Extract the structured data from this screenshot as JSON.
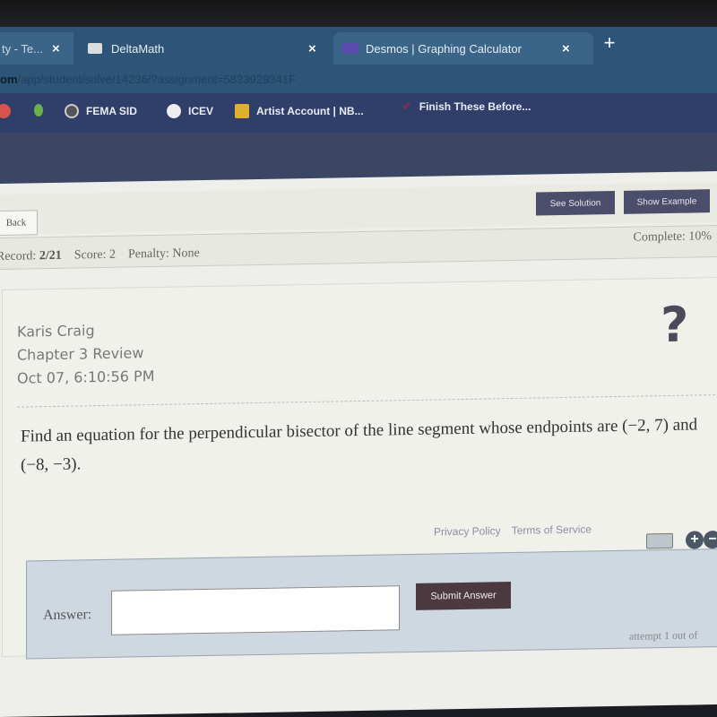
{
  "browser": {
    "tabs": [
      {
        "label": "ty - Te...",
        "state": "inactive"
      },
      {
        "label": "DeltaMath",
        "state": "active"
      },
      {
        "label": "Desmos | Graphing Calculator",
        "state": "inactive"
      }
    ],
    "close_glyph": "×",
    "new_tab_glyph": "+",
    "url_host": "om",
    "url_path": "/app/student/solve/14236/?assignment=5833929341F",
    "bookmarks": [
      {
        "label": ""
      },
      {
        "label": ""
      },
      {
        "label": "FEMA SID"
      },
      {
        "label": "ICEV"
      },
      {
        "label": "Artist Account | NB..."
      },
      {
        "label": "Finish These Before..."
      }
    ]
  },
  "toolbar": {
    "back_label": "Back",
    "see_solution_label": "See Solution",
    "show_example_label": "Show Example"
  },
  "status": {
    "record_label": "Record:",
    "record_value": "2/21",
    "score_label": "Score:",
    "score_value": "2",
    "penalty_label": "Penalty:",
    "penalty_value": "None",
    "complete_label": "Complete:",
    "complete_value": "10%"
  },
  "problem": {
    "student_name": "Karis Craig",
    "assignment": "Chapter 3 Review",
    "timestamp": "Oct 07, 6:10:56 PM",
    "help_glyph": "?",
    "question": "Find an equation for the perpendicular bisector of the line segment whose endpoints are (−2, 7) and (−8, −3)."
  },
  "answer": {
    "label": "Answer:",
    "value": "",
    "placeholder": "",
    "submit_label": "Submit Answer",
    "attempt_text": "attempt 1 out of",
    "plus_glyph": "+",
    "minus_glyph": "−"
  },
  "footer": {
    "privacy": "Privacy Policy",
    "terms": "Terms of Service"
  }
}
